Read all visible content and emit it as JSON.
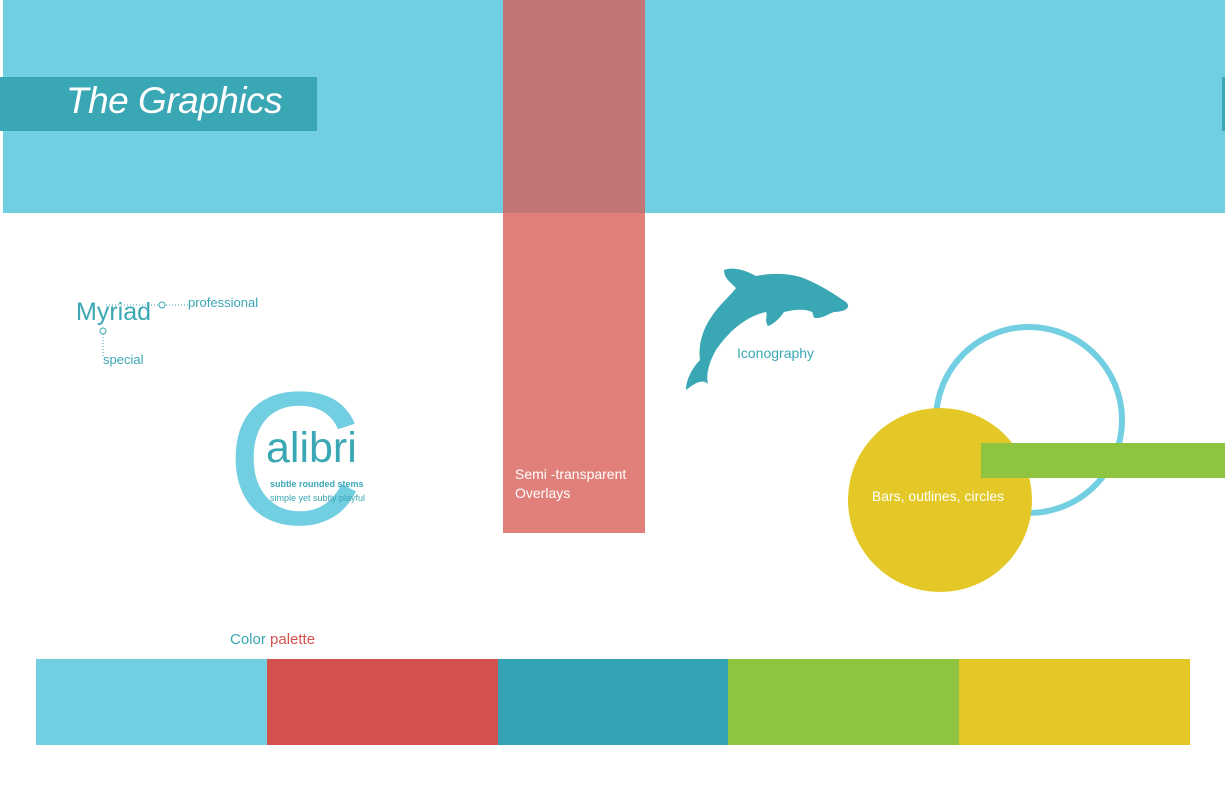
{
  "header": {
    "title": "The Graphics"
  },
  "overlay": {
    "label": "Semi -transparent Overlays"
  },
  "typography": {
    "myriad": {
      "word": "Myriad",
      "tags": [
        "professional",
        "special"
      ]
    },
    "calibri": {
      "initial": "C",
      "rest": "alibri",
      "notes": [
        "subtle rounded stems",
        "simple yet subtly playful"
      ]
    }
  },
  "iconography": {
    "label": "Iconography",
    "icon": "dolphin-icon"
  },
  "shapes": {
    "label": "Bars, outlines, circles"
  },
  "palette": {
    "title_part1": "Color",
    "title_part2": "palette",
    "swatches": [
      "#72cee1",
      "#d4524e",
      "#33a3b3",
      "#8fc441",
      "#e3c828"
    ]
  },
  "colors": {
    "light_blue": "#72cee1",
    "teal": "#3aa7b4",
    "red": "#d4524e",
    "green": "#8fc441",
    "yellow": "#e3c828"
  }
}
